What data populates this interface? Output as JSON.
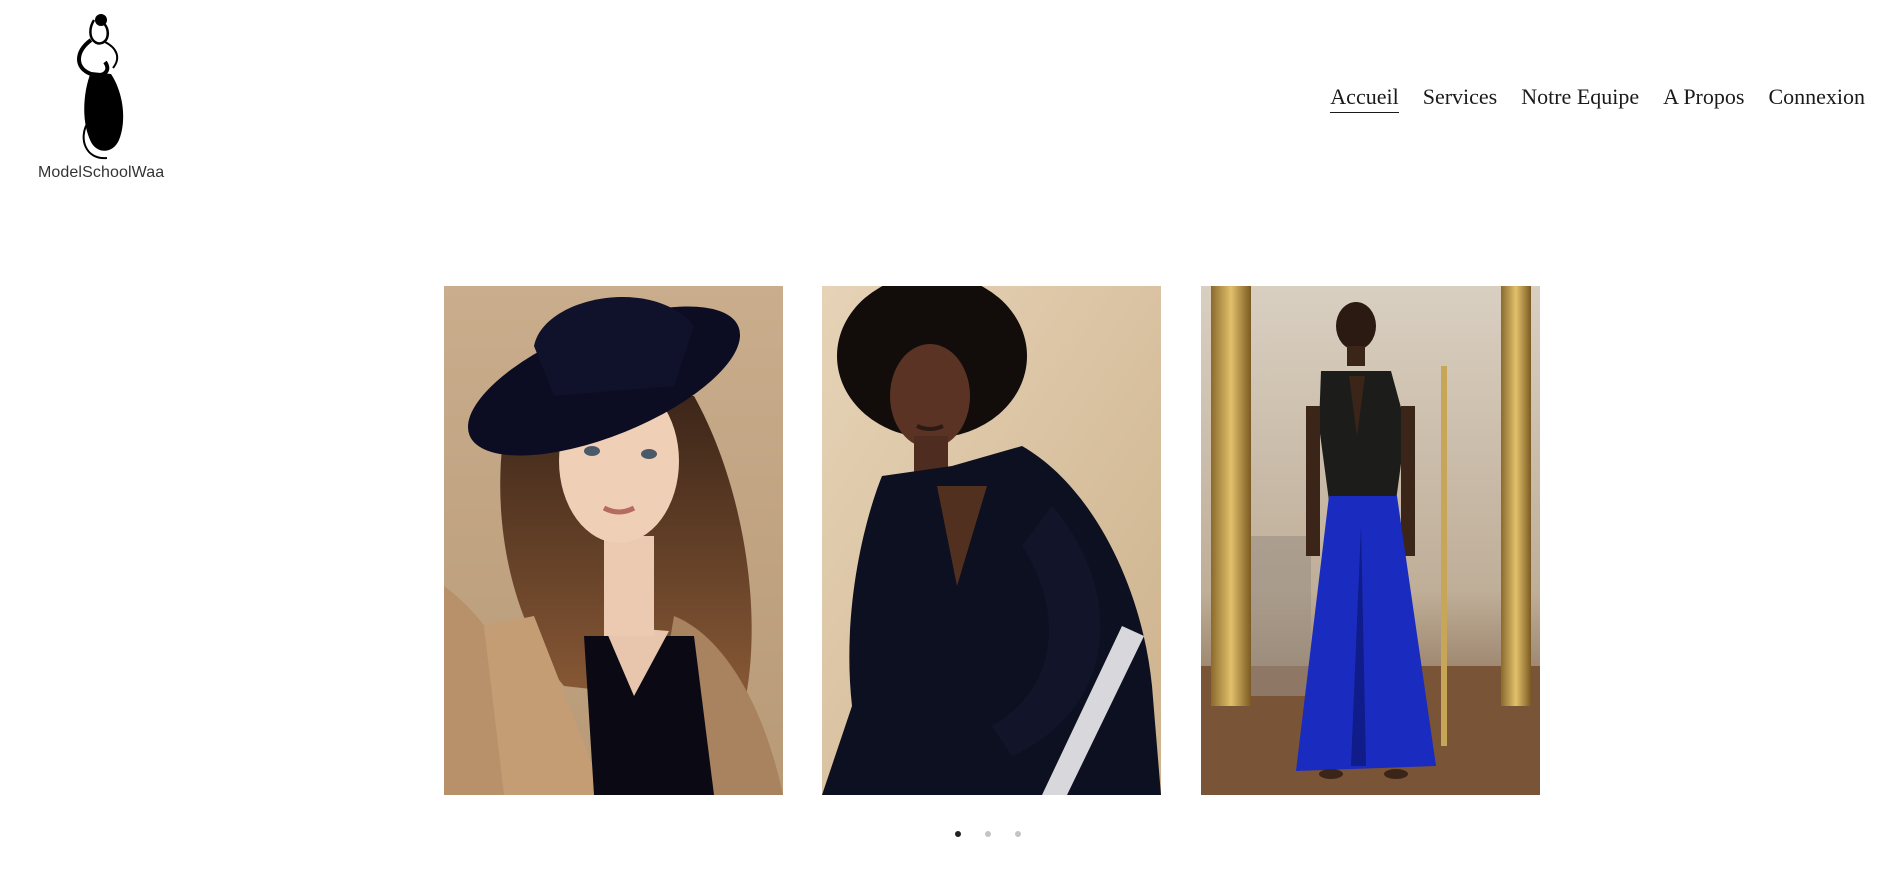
{
  "brand": {
    "name": "ModelSchoolWaa",
    "logo_icon": "woman-silhouette-logo"
  },
  "nav": {
    "items": [
      {
        "label": "Accueil",
        "active": true
      },
      {
        "label": "Services",
        "active": false
      },
      {
        "label": "Notre Equipe",
        "active": false
      },
      {
        "label": "A Propos",
        "active": false
      },
      {
        "label": "Connexion",
        "active": false
      }
    ]
  },
  "carousel": {
    "slides": [
      {
        "subject": "woman-with-black-hat-camel-coat"
      },
      {
        "subject": "woman-afro-black-outfit-striped-pants"
      },
      {
        "subject": "runway-model-blue-wide-pants"
      }
    ],
    "indicators": [
      {
        "active": true
      },
      {
        "active": false
      },
      {
        "active": false
      }
    ]
  },
  "colors": {
    "background": "#ffffff",
    "text": "#1a1a1a",
    "indicator_active": "#222222",
    "indicator_inactive": "#c4c4c4"
  }
}
